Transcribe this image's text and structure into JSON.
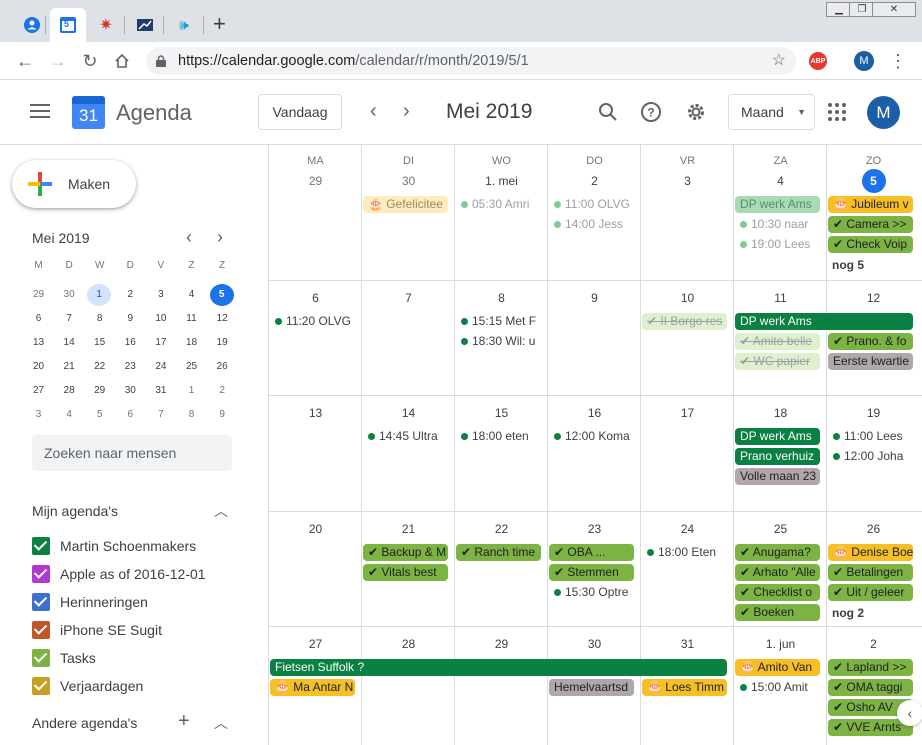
{
  "browser": {
    "url_host": "https://calendar.google.com",
    "url_path": "/calendar/r/month/2019/5/1",
    "abp_label": "ABP",
    "avatar_letter": "M",
    "tab_badge": "5"
  },
  "header": {
    "logo_day": "31",
    "app_name": "Agenda",
    "today_button": "Vandaag",
    "title": "Mei 2019",
    "view_select": "Maand",
    "avatar_letter": "M"
  },
  "sidebar": {
    "create_label": "Maken",
    "mini_title": "Mei 2019",
    "mini_weekdays": [
      "M",
      "D",
      "W",
      "D",
      "V",
      "Z",
      "Z"
    ],
    "mini_weeks": [
      [
        "29",
        "30",
        "1",
        "2",
        "3",
        "4",
        "5"
      ],
      [
        "6",
        "7",
        "8",
        "9",
        "10",
        "11",
        "12"
      ],
      [
        "13",
        "14",
        "15",
        "16",
        "17",
        "18",
        "19"
      ],
      [
        "20",
        "21",
        "22",
        "23",
        "24",
        "25",
        "26"
      ],
      [
        "27",
        "28",
        "29",
        "30",
        "31",
        "1",
        "2"
      ],
      [
        "3",
        "4",
        "5",
        "6",
        "7",
        "8",
        "9"
      ]
    ],
    "search_placeholder": "Zoeken naar mensen",
    "my_calendars_title": "Mijn agenda's",
    "calendars": [
      {
        "name": "Martin Schoenmakers",
        "color": "#0b8043"
      },
      {
        "name": "Apple as of 2016-12-01",
        "color": "#b039d4"
      },
      {
        "name": "Herinneringen",
        "color": "#3f6fd1"
      },
      {
        "name": "iPhone SE Sugit",
        "color": "#c0562a"
      },
      {
        "name": "Tasks",
        "color": "#7cb342"
      },
      {
        "name": "Verjaardagen",
        "color": "#c6a023"
      }
    ],
    "other_calendars_title": "Andere agenda's"
  },
  "month": {
    "weekdays": [
      "MA",
      "DI",
      "WO",
      "DO",
      "VR",
      "ZA",
      "ZO"
    ],
    "weeks": [
      [
        "29",
        "30",
        "1. mei",
        "2",
        "3",
        "4",
        "5"
      ],
      [
        "6",
        "7",
        "8",
        "9",
        "10",
        "11",
        "12"
      ],
      [
        "13",
        "14",
        "15",
        "16",
        "17",
        "18",
        "19"
      ],
      [
        "20",
        "21",
        "22",
        "23",
        "24",
        "25",
        "26"
      ],
      [
        "27",
        "28",
        "29",
        "30",
        "31",
        "1. jun",
        "2"
      ]
    ],
    "events": [
      {
        "week": 0,
        "col": 1,
        "slot": 0,
        "span": 1,
        "style": "yl",
        "text": "🎂 Gefelicitee"
      },
      {
        "week": 0,
        "col": 2,
        "slot": 0,
        "span": 1,
        "style": "dotl",
        "text": "05:30 Amri"
      },
      {
        "week": 0,
        "col": 3,
        "slot": 0,
        "span": 1,
        "style": "dotl",
        "text": "11:00 OLVG"
      },
      {
        "week": 0,
        "col": 3,
        "slot": 1,
        "span": 1,
        "style": "dotl",
        "text": "14:00 Jess"
      },
      {
        "week": 0,
        "col": 5,
        "slot": 0,
        "span": 1,
        "style": "gl",
        "text": "DP werk Ams"
      },
      {
        "week": 0,
        "col": 5,
        "slot": 1,
        "span": 1,
        "style": "dotl",
        "text": "10:30 naar"
      },
      {
        "week": 0,
        "col": 5,
        "slot": 2,
        "span": 1,
        "style": "dotl",
        "text": "19:00 Lees"
      },
      {
        "week": 0,
        "col": 6,
        "slot": 0,
        "span": 1,
        "style": "y",
        "text": "🎂 Jubileum v"
      },
      {
        "week": 0,
        "col": 6,
        "slot": 1,
        "span": 1,
        "style": "lg",
        "text": "✔ Camera >>"
      },
      {
        "week": 0,
        "col": 6,
        "slot": 2,
        "span": 1,
        "style": "lg",
        "text": "✔ Check Voip"
      },
      {
        "week": 1,
        "col": 0,
        "slot": 0,
        "span": 1,
        "style": "dot",
        "text": "11:20 OLVG"
      },
      {
        "week": 1,
        "col": 2,
        "slot": 0,
        "span": 1,
        "style": "dot",
        "text": "15:15 Met F"
      },
      {
        "week": 1,
        "col": 2,
        "slot": 1,
        "span": 1,
        "style": "dot",
        "text": "18:30 Wil: u"
      },
      {
        "week": 1,
        "col": 4,
        "slot": 0,
        "span": 1,
        "style": "lgt",
        "text": "✔ II Borgo res"
      },
      {
        "week": 1,
        "col": 5,
        "slot": 0,
        "span": 2,
        "style": "g",
        "text": "DP werk Ams"
      },
      {
        "week": 1,
        "col": 5,
        "slot": 1,
        "span": 1,
        "style": "lgt",
        "text": "✔ Amito belle"
      },
      {
        "week": 1,
        "col": 5,
        "slot": 2,
        "span": 1,
        "style": "lgt",
        "text": "✔ WC papier"
      },
      {
        "week": 1,
        "col": 6,
        "slot": 1,
        "span": 1,
        "style": "lg",
        "text": "✔ Prano. & fo"
      },
      {
        "week": 1,
        "col": 6,
        "slot": 2,
        "span": 1,
        "style": "gr",
        "text": "Eerste kwartie"
      },
      {
        "week": 2,
        "col": 1,
        "slot": 0,
        "span": 1,
        "style": "dot",
        "text": "14:45 Ultra"
      },
      {
        "week": 2,
        "col": 2,
        "slot": 0,
        "span": 1,
        "style": "dot",
        "text": "18:00 eten"
      },
      {
        "week": 2,
        "col": 3,
        "slot": 0,
        "span": 1,
        "style": "dot",
        "text": "12:00 Koma"
      },
      {
        "week": 2,
        "col": 5,
        "slot": 0,
        "span": 1,
        "style": "g",
        "text": "DP werk Ams"
      },
      {
        "week": 2,
        "col": 5,
        "slot": 1,
        "span": 1,
        "style": "g",
        "text": "Prano verhuiz"
      },
      {
        "week": 2,
        "col": 5,
        "slot": 2,
        "span": 1,
        "style": "gr",
        "text": "Volle maan 23"
      },
      {
        "week": 2,
        "col": 6,
        "slot": 0,
        "span": 1,
        "style": "dot",
        "text": "11:00 Lees"
      },
      {
        "week": 2,
        "col": 6,
        "slot": 1,
        "span": 1,
        "style": "dot",
        "text": "12:00 Joha"
      },
      {
        "week": 3,
        "col": 1,
        "slot": 0,
        "span": 1,
        "style": "lg",
        "text": "✔ Backup & M"
      },
      {
        "week": 3,
        "col": 1,
        "slot": 1,
        "span": 1,
        "style": "lg",
        "text": "✔ Vitals best"
      },
      {
        "week": 3,
        "col": 2,
        "slot": 0,
        "span": 1,
        "style": "lg",
        "text": "✔ Ranch time"
      },
      {
        "week": 3,
        "col": 3,
        "slot": 0,
        "span": 1,
        "style": "lg",
        "text": "✔ OBA ..."
      },
      {
        "week": 3,
        "col": 3,
        "slot": 1,
        "span": 1,
        "style": "lg",
        "text": "✔ Stemmen"
      },
      {
        "week": 3,
        "col": 3,
        "slot": 2,
        "span": 1,
        "style": "dot",
        "text": "15:30 Optre"
      },
      {
        "week": 3,
        "col": 4,
        "slot": 0,
        "span": 1,
        "style": "dot",
        "text": "18:00 Eten"
      },
      {
        "week": 3,
        "col": 5,
        "slot": 0,
        "span": 1,
        "style": "lg",
        "text": "✔ Anugama?"
      },
      {
        "week": 3,
        "col": 5,
        "slot": 1,
        "span": 1,
        "style": "lg",
        "text": "✔ Arhato \"Alle"
      },
      {
        "week": 3,
        "col": 5,
        "slot": 2,
        "span": 1,
        "style": "lg",
        "text": "✔ Checklist o"
      },
      {
        "week": 3,
        "col": 5,
        "slot": 3,
        "span": 1,
        "style": "lg",
        "text": "✔ Boeken"
      },
      {
        "week": 3,
        "col": 6,
        "slot": 0,
        "span": 1,
        "style": "y",
        "text": "🎂 Denise Boe"
      },
      {
        "week": 3,
        "col": 6,
        "slot": 1,
        "span": 1,
        "style": "lg",
        "text": "✔ Betalingen"
      },
      {
        "week": 3,
        "col": 6,
        "slot": 2,
        "span": 1,
        "style": "lg",
        "text": "✔ Uit / geleer"
      },
      {
        "week": 4,
        "col": 0,
        "slot": 0,
        "span": 5,
        "style": "g",
        "text": "Fietsen Suffolk ?"
      },
      {
        "week": 4,
        "col": 0,
        "slot": 1,
        "span": 1,
        "style": "y",
        "text": "🎂 Ma Antar N"
      },
      {
        "week": 4,
        "col": 3,
        "slot": 1,
        "span": 1,
        "style": "gr",
        "text": "Hemelvaartsd"
      },
      {
        "week": 4,
        "col": 4,
        "slot": 1,
        "span": 1,
        "style": "y",
        "text": "🎂 Loes Timm"
      },
      {
        "week": 4,
        "col": 5,
        "slot": 0,
        "span": 1,
        "style": "y",
        "text": "🎂 Amito Van"
      },
      {
        "week": 4,
        "col": 5,
        "slot": 1,
        "span": 1,
        "style": "dot",
        "text": "15:00 Amit"
      },
      {
        "week": 4,
        "col": 6,
        "slot": 0,
        "span": 1,
        "style": "lg",
        "text": "✔ Lapland >>"
      },
      {
        "week": 4,
        "col": 6,
        "slot": 1,
        "span": 1,
        "style": "lg",
        "text": "✔ OMA taggi"
      },
      {
        "week": 4,
        "col": 6,
        "slot": 2,
        "span": 1,
        "style": "lg",
        "text": "✔ Osho AV"
      },
      {
        "week": 4,
        "col": 6,
        "slot": 3,
        "span": 1,
        "style": "lg",
        "text": "✔ VVE Arnts"
      }
    ],
    "more": [
      {
        "week": 0,
        "col": 6,
        "text": "nog 5"
      },
      {
        "week": 3,
        "col": 6,
        "text": "nog 2"
      }
    ]
  }
}
